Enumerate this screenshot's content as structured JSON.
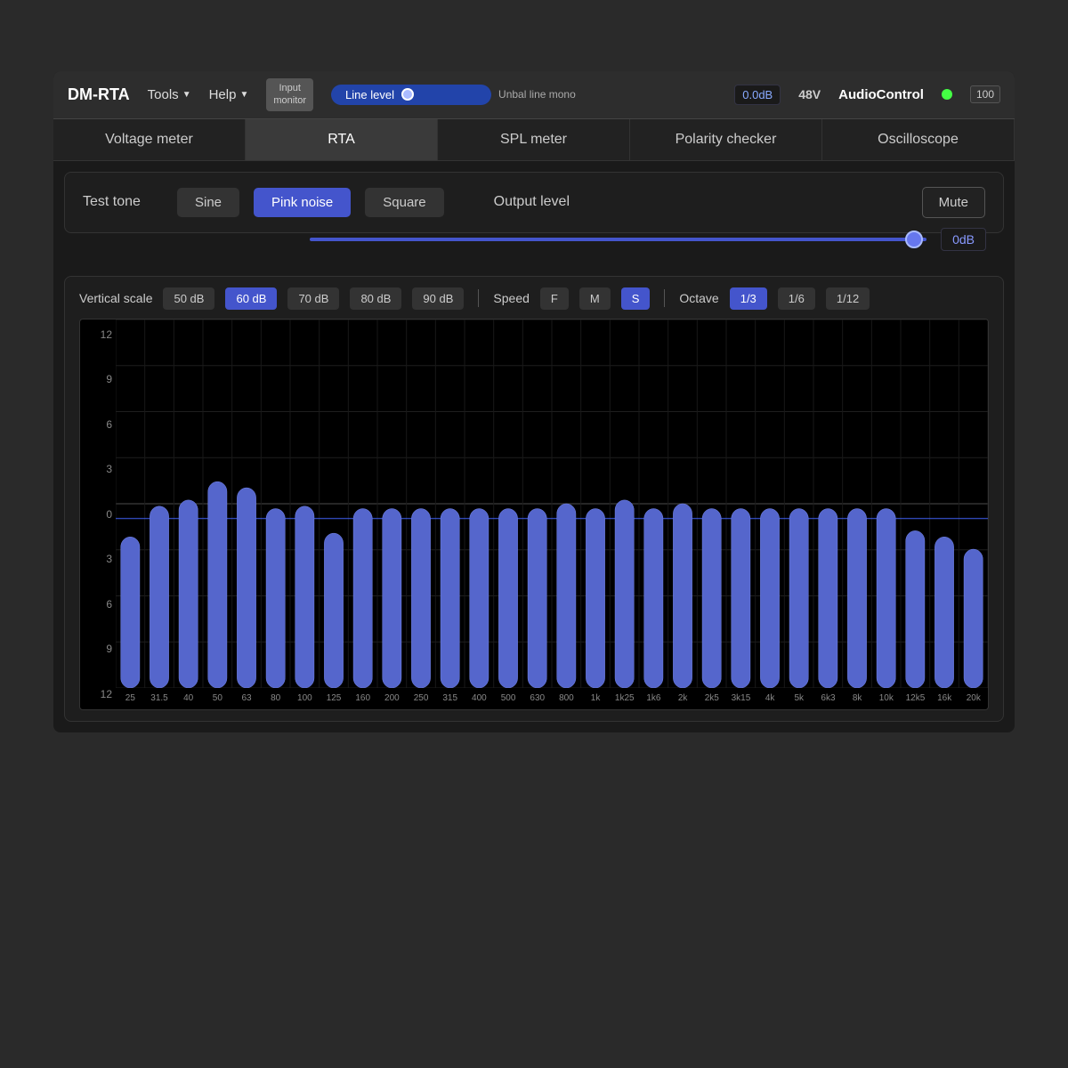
{
  "app": {
    "title": "DM-RTA",
    "menu_tools": "Tools",
    "menu_help": "Help",
    "input_monitor": "Input\nmonitor",
    "line_level": "Line level",
    "unbal": "Unbal line mono",
    "db_value": "0.0dB",
    "v48": "48V",
    "logo": "AudioControl",
    "level_badge": "100",
    "green_dot_label": "active"
  },
  "tabs": [
    {
      "id": "voltage",
      "label": "Voltage meter",
      "active": false
    },
    {
      "id": "rta",
      "label": "RTA",
      "active": true
    },
    {
      "id": "spl",
      "label": "SPL meter",
      "active": false
    },
    {
      "id": "polarity",
      "label": "Polarity checker",
      "active": false
    },
    {
      "id": "oscilloscope",
      "label": "Oscilloscope",
      "active": false
    }
  ],
  "test_tone": {
    "label": "Test tone",
    "buttons": [
      {
        "id": "sine",
        "label": "Sine",
        "active": false
      },
      {
        "id": "pink_noise",
        "label": "Pink noise",
        "active": true
      },
      {
        "id": "square",
        "label": "Square",
        "active": false
      }
    ],
    "output_level_label": "Output level",
    "mute_label": "Mute",
    "slider_value": "0dB"
  },
  "rta": {
    "vertical_scale_label": "Vertical scale",
    "vertical_scale_options": [
      {
        "label": "50 dB",
        "active": false
      },
      {
        "label": "60 dB",
        "active": true
      },
      {
        "label": "70 dB",
        "active": false
      },
      {
        "label": "80 dB",
        "active": false
      },
      {
        "label": "90 dB",
        "active": false
      }
    ],
    "speed_label": "Speed",
    "speed_options": [
      {
        "label": "F",
        "active": false
      },
      {
        "label": "M",
        "active": false
      },
      {
        "label": "S",
        "active": true
      }
    ],
    "octave_label": "Octave",
    "octave_options": [
      {
        "label": "1/3",
        "active": true
      },
      {
        "label": "1/6",
        "active": false
      },
      {
        "label": "1/12",
        "active": false
      }
    ],
    "y_labels": [
      "12",
      "9",
      "6",
      "3",
      "0",
      "3",
      "6",
      "9",
      "12"
    ],
    "x_labels": [
      "25",
      "31.5",
      "40",
      "50",
      "63",
      "80",
      "100",
      "125",
      "160",
      "200",
      "250",
      "315",
      "400",
      "500",
      "630",
      "800",
      "1k",
      "1k25",
      "1k6",
      "2k",
      "2k5",
      "3k15",
      "4k",
      "5k",
      "6k3",
      "8k",
      "10k",
      "12k5",
      "16k",
      "20k"
    ],
    "bars": [
      {
        "freq": "25",
        "value": -1.5
      },
      {
        "freq": "31.5",
        "value": 1.0
      },
      {
        "freq": "40",
        "value": 1.5
      },
      {
        "freq": "50",
        "value": 3.0
      },
      {
        "freq": "63",
        "value": 2.5
      },
      {
        "freq": "80",
        "value": 0.8
      },
      {
        "freq": "100",
        "value": 1.0
      },
      {
        "freq": "125",
        "value": -1.2
      },
      {
        "freq": "160",
        "value": 0.8
      },
      {
        "freq": "200",
        "value": 0.8
      },
      {
        "freq": "250",
        "value": 0.8
      },
      {
        "freq": "315",
        "value": 0.8
      },
      {
        "freq": "400",
        "value": 0.8
      },
      {
        "freq": "500",
        "value": 0.8
      },
      {
        "freq": "630",
        "value": 0.8
      },
      {
        "freq": "800",
        "value": 1.2
      },
      {
        "freq": "1k",
        "value": 0.8
      },
      {
        "freq": "1k25",
        "value": 1.5
      },
      {
        "freq": "1k6",
        "value": 0.8
      },
      {
        "freq": "2k",
        "value": 1.2
      },
      {
        "freq": "2k5",
        "value": 0.8
      },
      {
        "freq": "3k15",
        "value": 0.8
      },
      {
        "freq": "4k",
        "value": 0.8
      },
      {
        "freq": "5k",
        "value": 0.8
      },
      {
        "freq": "6k3",
        "value": 0.8
      },
      {
        "freq": "8k",
        "value": 0.8
      },
      {
        "freq": "10k",
        "value": 0.8
      },
      {
        "freq": "12k5",
        "value": -1.0
      },
      {
        "freq": "16k",
        "value": -1.5
      },
      {
        "freq": "20k",
        "value": -2.5
      }
    ]
  }
}
